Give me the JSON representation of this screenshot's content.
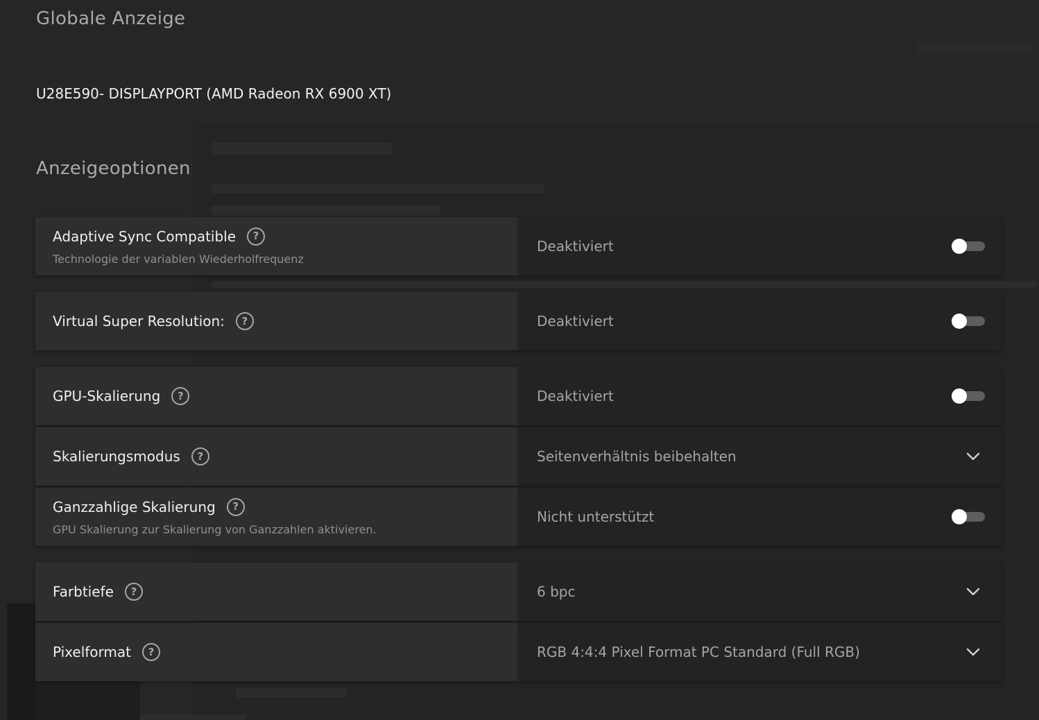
{
  "header": {
    "title": "Globale Anzeige",
    "display_name": "U28E590- DISPLAYPORT (AMD Radeon RX 6900 XT)"
  },
  "section": {
    "title": "Anzeigeoptionen"
  },
  "settings": [
    {
      "label": "Adaptive Sync Compatible",
      "description": "Technologie der variablen Wiederholfrequenz",
      "value": "Deaktiviert",
      "control": "toggle",
      "state": "off"
    },
    {
      "label": "Virtual Super Resolution:",
      "value": "Deaktiviert",
      "control": "toggle",
      "state": "off"
    },
    {
      "label": "GPU-Skalierung",
      "value": "Deaktiviert",
      "control": "toggle",
      "state": "off"
    },
    {
      "label": "Skalierungsmodus",
      "value": "Seitenverhältnis beibehalten",
      "control": "dropdown"
    },
    {
      "label": "Ganzzahlige Skalierung",
      "description": "GPU Skalierung zur Skalierung von Ganzzahlen aktivieren.",
      "value": "Nicht unterstützt",
      "control": "toggle",
      "state": "off"
    },
    {
      "label": "Farbtiefe",
      "value": "6 bpc",
      "control": "dropdown"
    },
    {
      "label": "Pixelformat",
      "value": "RGB 4:4:4 Pixel Format PC Standard (Full RGB)",
      "control": "dropdown"
    }
  ],
  "icons": {
    "help": "question-circle-icon",
    "dropdown": "chevron-down-icon"
  },
  "colors": {
    "background": "#262626",
    "row_label_bg": "#2e2e2e",
    "row_value_bg": "#232323",
    "toggle_track": "#5e5e5e",
    "toggle_knob": "#ffffff"
  }
}
